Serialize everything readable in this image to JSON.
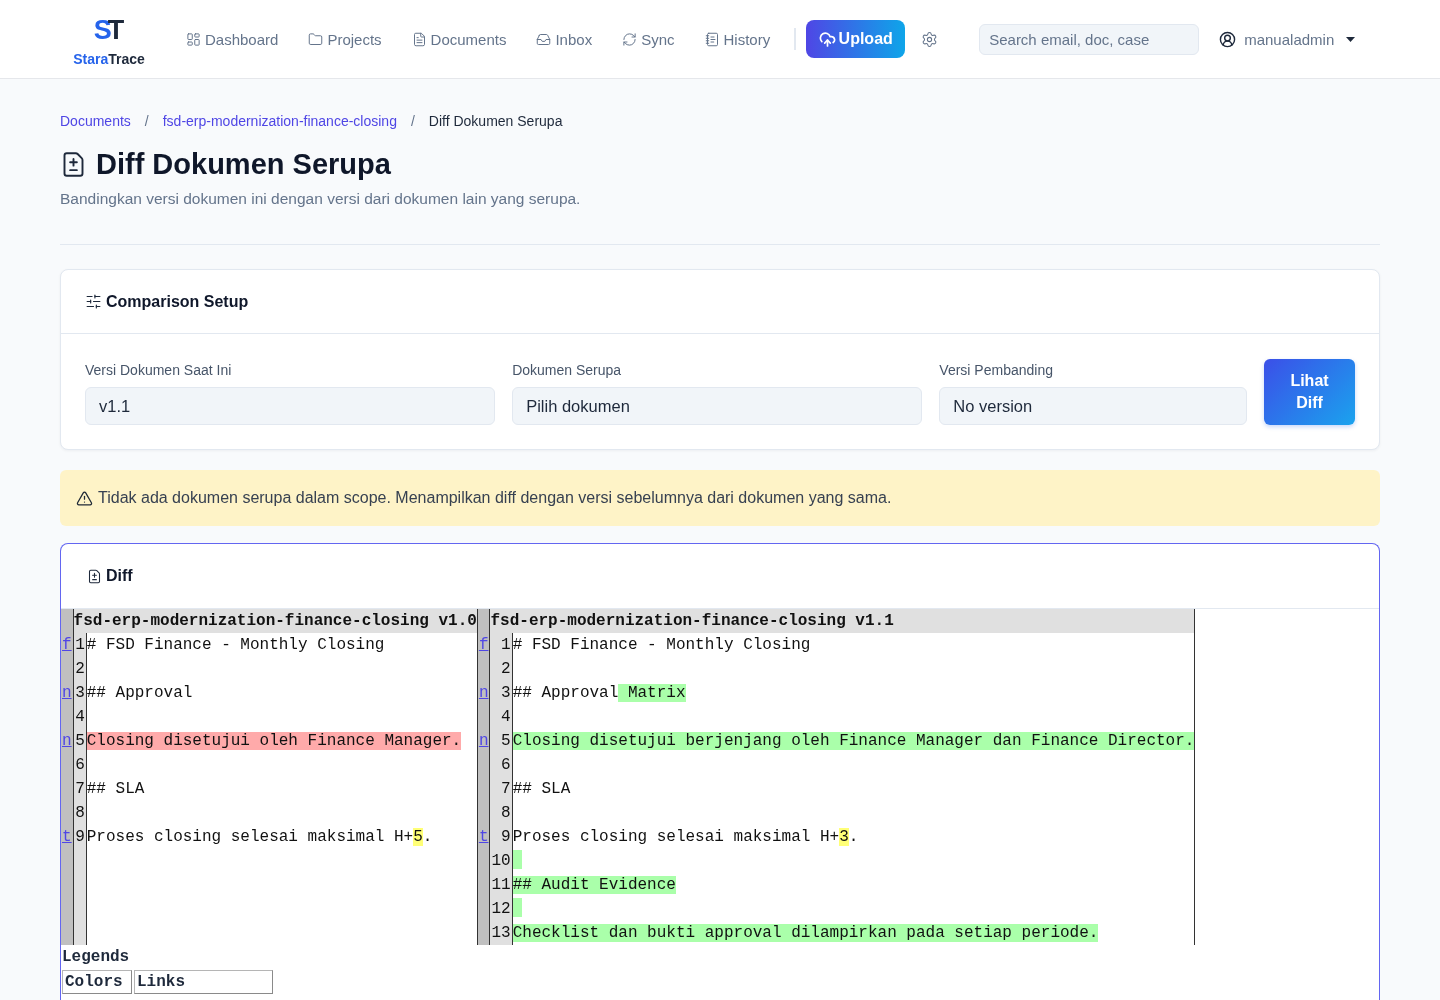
{
  "brand": {
    "monogram": "ST",
    "name_parts": [
      "Stara",
      "Trace"
    ]
  },
  "nav": {
    "items": [
      {
        "label": "Dashboard",
        "selected": false
      },
      {
        "label": "Projects",
        "selected": false
      },
      {
        "label": "Documents",
        "selected": false
      },
      {
        "label": "Inbox",
        "selected": false
      },
      {
        "label": "Sync",
        "selected": false
      },
      {
        "label": "History",
        "selected": false
      }
    ],
    "upload_button": "Upload",
    "search": {
      "placeholder": "Search email, doc, case"
    },
    "user": {
      "name": "manualadmin"
    }
  },
  "breadcrumb": [
    {
      "kind": "link",
      "text": "Documents"
    },
    {
      "kind": "separator",
      "text": "/"
    },
    {
      "kind": "link",
      "text": "fsd-erp-modernization-finance-closing"
    },
    {
      "kind": "separator",
      "text": "/"
    },
    {
      "kind": "current",
      "text": "Diff Dokumen Serupa"
    }
  ],
  "page": {
    "title": "Diff Dokumen Serupa",
    "subtitle": "Bandingkan versi dokumen ini dengan versi dari dokumen lain yang serupa."
  },
  "comparison_setup": {
    "title": "Comparison Setup",
    "fields": [
      {
        "label": "Versi Dokumen Saat Ini",
        "value": "v1.1"
      },
      {
        "label": "Dokumen Serupa",
        "value": "Pilih dokumen"
      },
      {
        "label": "Versi Pembanding",
        "value": "No version"
      }
    ],
    "button": "Lihat Diff"
  },
  "alert": {
    "kind": "warning",
    "text": "Tidak ada dokumen serupa dalam scope. Menampilkan diff dengan versi sebelumnya dari dokumen yang sama."
  },
  "diff": {
    "title": "Diff",
    "from_title": "fsd-erp-modernization-finance-closing v1.0",
    "to_title": "fsd-erp-modernization-finance-closing v1.1",
    "rows": [
      {
        "left": {
          "next": "f",
          "number": "1",
          "segments": [
            {
              "kind": "same",
              "text": "# FSD Finance - Monthly Closing"
            }
          ]
        },
        "right": {
          "next": "f",
          "number": "1",
          "segments": [
            {
              "kind": "same",
              "text": "# FSD Finance - Monthly Closing"
            }
          ]
        }
      },
      {
        "left": {
          "number": "2"
        },
        "right": {
          "number": "2"
        }
      },
      {
        "left": {
          "next": "n",
          "number": "3",
          "segments": [
            {
              "kind": "same",
              "text": "## Approval"
            }
          ]
        },
        "right": {
          "next": "n",
          "number": "3",
          "segments": [
            {
              "kind": "same",
              "text": "## Approval"
            },
            {
              "kind": "add",
              "text": " Matrix"
            }
          ]
        }
      },
      {
        "left": {
          "number": "4"
        },
        "right": {
          "number": "4"
        }
      },
      {
        "left": {
          "next": "n",
          "number": "5",
          "segments": [
            {
              "kind": "sub",
              "text": "Closing disetujui oleh Finance Manager."
            }
          ]
        },
        "right": {
          "next": "n",
          "number": "5",
          "segments": [
            {
              "kind": "add",
              "text": "Closing disetujui berjenjang oleh Finance Manager dan Finance Director."
            }
          ]
        }
      },
      {
        "left": {
          "number": "6"
        },
        "right": {
          "number": "6"
        }
      },
      {
        "left": {
          "number": "7",
          "segments": [
            {
              "kind": "same",
              "text": "## SLA"
            }
          ]
        },
        "right": {
          "number": "7",
          "segments": [
            {
              "kind": "same",
              "text": "## SLA"
            }
          ]
        }
      },
      {
        "left": {
          "number": "8"
        },
        "right": {
          "number": "8"
        }
      },
      {
        "left": {
          "next": "t",
          "number": "9",
          "segments": [
            {
              "kind": "same",
              "text": "Proses closing selesai maksimal H+"
            },
            {
              "kind": "chg",
              "text": "5"
            },
            {
              "kind": "same",
              "text": "."
            }
          ]
        },
        "right": {
          "next": "t",
          "number": "9",
          "segments": [
            {
              "kind": "same",
              "text": "Proses closing selesai maksimal H+"
            },
            {
              "kind": "chg",
              "text": "3"
            },
            {
              "kind": "same",
              "text": "."
            }
          ]
        }
      },
      {
        "right": {
          "number": "10",
          "segments": [
            {
              "kind": "add"
            }
          ]
        }
      },
      {
        "right": {
          "number": "11",
          "segments": [
            {
              "kind": "add",
              "text": "## Audit Evidence"
            }
          ]
        }
      },
      {
        "right": {
          "number": "12",
          "segments": [
            {
              "kind": "add"
            }
          ]
        }
      },
      {
        "right": {
          "number": "13",
          "segments": [
            {
              "kind": "add",
              "text": "Checklist dan bukti approval dilampirkan pada setiap periode."
            }
          ]
        }
      }
    ],
    "legend": {
      "title": "Legends",
      "sections": [
        "Colors",
        "Links"
      ]
    }
  }
}
